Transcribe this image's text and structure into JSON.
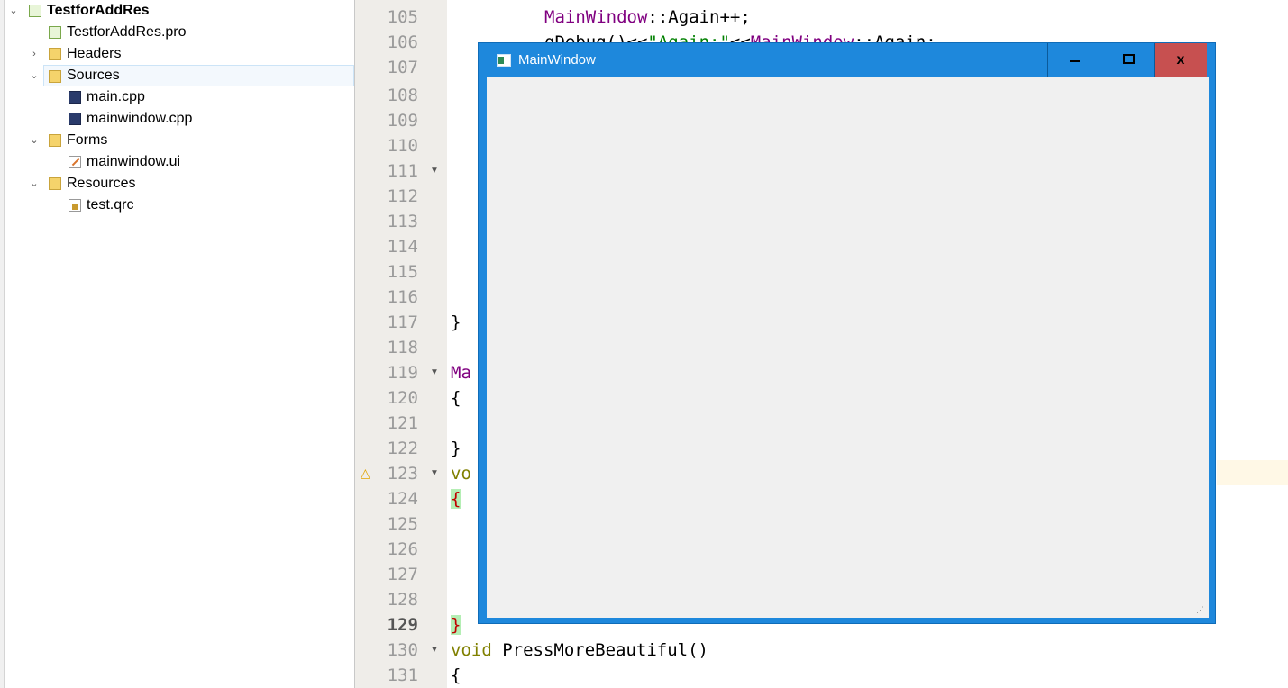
{
  "tree": {
    "items": [
      {
        "label": "TestforAddRes",
        "chev": "⌄",
        "icon": "qt-project-icon"
      },
      {
        "label": "TestforAddRes.pro",
        "icon": "pro-file-icon"
      },
      {
        "label": "Headers",
        "chev": "›",
        "icon": "headers-folder-icon"
      },
      {
        "label": "Sources",
        "chev": "⌄",
        "icon": "sources-folder-icon"
      },
      {
        "label": "main.cpp",
        "icon": "cpp-file-icon"
      },
      {
        "label": "mainwindow.cpp",
        "icon": "cpp-file-icon"
      },
      {
        "label": "Forms",
        "chev": "⌄",
        "icon": "forms-folder-icon"
      },
      {
        "label": "mainwindow.ui",
        "icon": "ui-file-icon"
      },
      {
        "label": "Resources",
        "chev": "⌄",
        "icon": "resources-folder-icon"
      },
      {
        "label": "test.qrc",
        "icon": "qrc-file-icon"
      }
    ],
    "selected": "Sources"
  },
  "editor": {
    "line_numbers": [
      "105",
      "106",
      "107",
      "108",
      "109",
      "110",
      "111",
      "112",
      "113",
      "114",
      "115",
      "116",
      "117",
      "118",
      "119",
      "120",
      "121",
      "122",
      "123",
      "124",
      "125",
      "126",
      "127",
      "128",
      "129",
      "130",
      "131"
    ],
    "current_line": "129",
    "lines": {
      "l105": {
        "a": "MainWindow",
        "b": "::Again++;"
      },
      "l106": {
        "a": "qDebug()<<",
        "b": "\"Again:\"",
        "c": "<<",
        "d": "MainWindow",
        "e": "::Again;"
      },
      "l117": "}",
      "l119": "Ma",
      "l120": "{",
      "l122": "}",
      "l123": "vo",
      "l124": "{",
      "l129": "}",
      "l130": {
        "kw": "void",
        "rest": " PressMoreBeautiful()"
      },
      "l131": "{"
    },
    "colors": {
      "keyword": "#808000",
      "class": "#800080",
      "string": "#008000"
    }
  },
  "window": {
    "title": "MainWindow",
    "buttons": {
      "minimize": "",
      "maximize": "",
      "close": "x"
    },
    "accent": "#1e88dc",
    "close_color": "#c75050"
  }
}
